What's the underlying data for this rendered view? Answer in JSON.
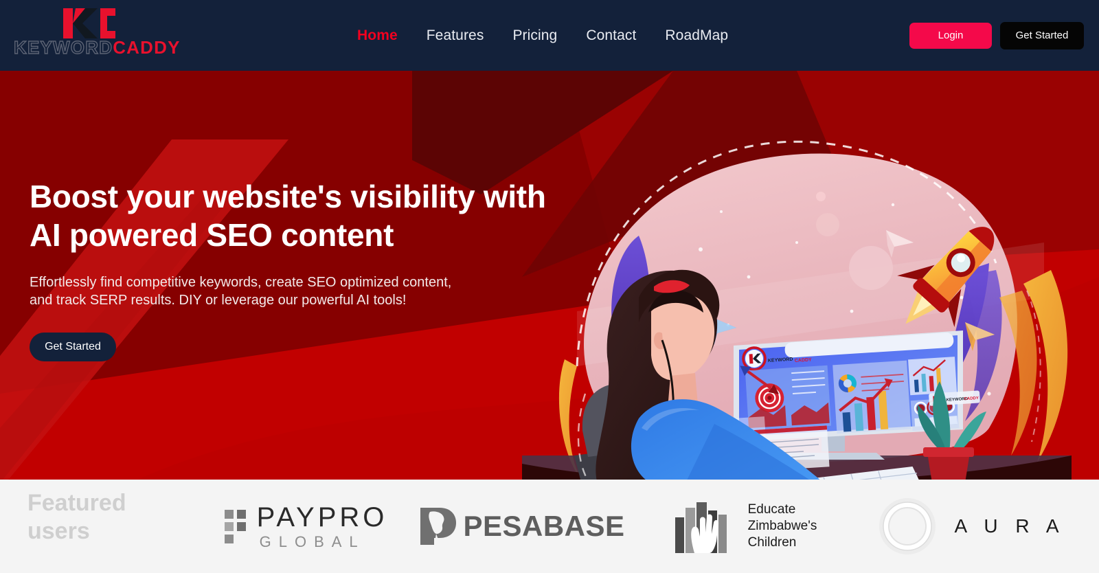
{
  "brand": {
    "logo_word_1": "KEYWORD",
    "logo_word_2": "CADDY",
    "accent_red": "#e8112d",
    "header_navy": "#13213a",
    "login_pink": "#f4094a"
  },
  "header": {
    "nav": [
      {
        "label": "Home",
        "active": true
      },
      {
        "label": "Features",
        "active": false
      },
      {
        "label": "Pricing",
        "active": false
      },
      {
        "label": "Contact",
        "active": false
      },
      {
        "label": "RoadMap",
        "active": false
      }
    ],
    "login_label": "Login",
    "get_started_label": "Get Started"
  },
  "hero": {
    "title_line_1": "Boost your website's visibility with",
    "title_line_2": "AI powered SEO content",
    "subtitle_line_1": "Effortlessly find competitive keywords, create SEO optimized content,",
    "subtitle_line_2": "and track SERP results. DIY or leverage our powerful AI tools!",
    "cta_label": "Get Started",
    "background_color": "#860000",
    "accent_band_color": "#c80000",
    "illustration": {
      "name": "woman-at-desktop-seo-dashboard-illustration",
      "screen_logo_text_1": "KEYWORD",
      "screen_logo_text_2": "CADDY",
      "elements": [
        "rocket",
        "paper-plane",
        "magnifying-glass",
        "dart-target",
        "bar-chart",
        "line-chart",
        "donut-chart",
        "potted-plant",
        "keyboard",
        "monitor",
        "dashed-arc",
        "floating-circles"
      ]
    }
  },
  "featured": {
    "label_line_1": "Featured",
    "label_line_2": "users",
    "background_color": "#f4f4f4",
    "logos": [
      {
        "name": "paypro-global",
        "text_main": "PAYPRO",
        "text_sub": "GLOBAL"
      },
      {
        "name": "pesabase",
        "text_main": "PESABASE"
      },
      {
        "name": "educate-zimbabwes-children",
        "line_1": "Educate",
        "line_2": "Zimbabwe's",
        "line_3": "Children"
      },
      {
        "name": "aura",
        "text_main": "A U R A"
      }
    ]
  }
}
